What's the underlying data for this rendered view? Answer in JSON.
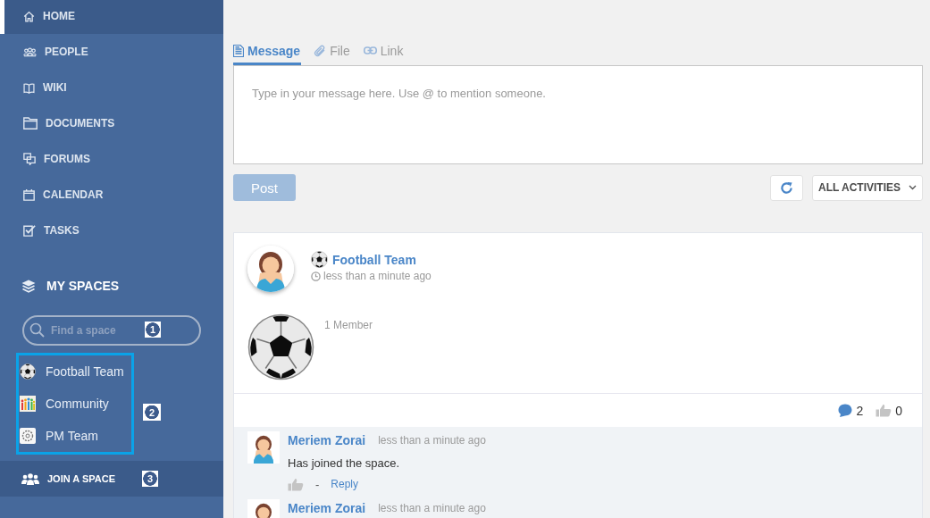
{
  "sidebar": {
    "nav": [
      {
        "label": "HOME",
        "selected": true
      },
      {
        "label": "PEOPLE",
        "selected": false
      },
      {
        "label": "WIKI",
        "selected": false
      },
      {
        "label": "DOCUMENTS",
        "selected": false
      },
      {
        "label": "FORUMS",
        "selected": false
      },
      {
        "label": "CALENDAR",
        "selected": false
      },
      {
        "label": "TASKS",
        "selected": false
      }
    ],
    "spaces_title": "MY SPACES",
    "space_search": {
      "placeholder": "Find a space",
      "step": "1"
    },
    "spaces": {
      "highlighted": true,
      "step": "2",
      "items": [
        {
          "name": "Football Team"
        },
        {
          "name": "Community"
        },
        {
          "name": "PM Team"
        }
      ]
    },
    "join_space": {
      "label": "JOIN A SPACE",
      "step": "3"
    }
  },
  "composer": {
    "tabs": [
      {
        "label": "Message",
        "selected": true
      },
      {
        "label": "File",
        "selected": false
      },
      {
        "label": "Link",
        "selected": false
      }
    ],
    "message": {
      "placeholder": "Type in your message here. Use @ to mention someone."
    },
    "post_button": {
      "label": "Post",
      "disabled": true
    },
    "filter": "ALL ACTIVITIES"
  },
  "activity": {
    "space": "Football Team",
    "time": "less than a minute ago",
    "members": "1 Member",
    "comment_count": "2",
    "like_count": "0",
    "comments": [
      {
        "author": "Meriem Zorai",
        "time": "less than a minute ago",
        "text": "Has joined the space.",
        "separator": "-",
        "reply": "Reply"
      },
      {
        "author": "Meriem Zorai",
        "time": "less than a minute ago"
      }
    ]
  }
}
